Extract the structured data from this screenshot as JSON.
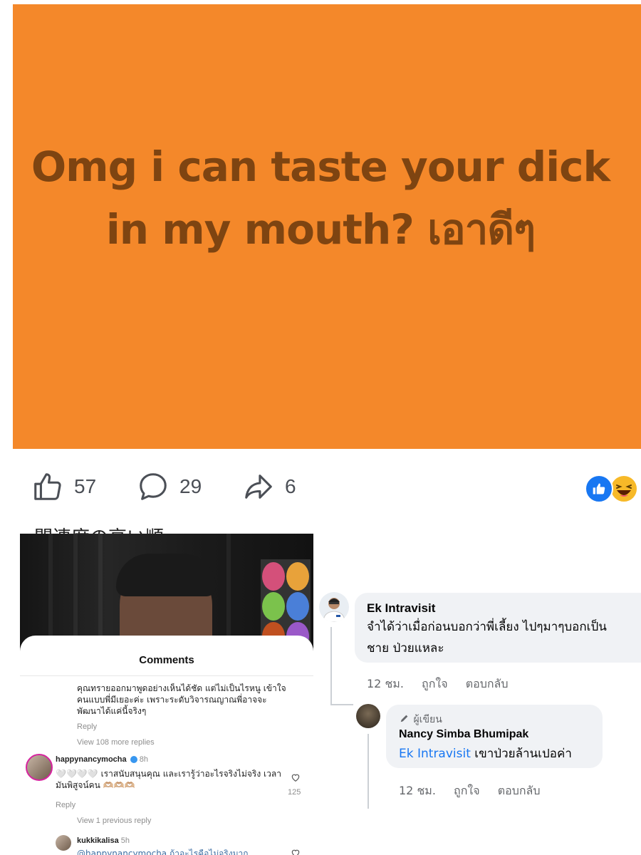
{
  "post": {
    "text": "Omg i can taste your dick in my mouth? เอาดีๆ",
    "background": "#f4882a",
    "text_color": "#7e4411"
  },
  "actions": {
    "like_icon": "thumbs-up-icon",
    "like_count": "57",
    "comment_icon": "comment-bubble-icon",
    "comment_count": "29",
    "share_icon": "share-arrow-icon",
    "share_count": "6",
    "reactions": [
      "like-reaction-icon",
      "haha-reaction-icon"
    ]
  },
  "left_screenshot": {
    "cut_title": "関連度の高い順",
    "sheet_title": "Comments",
    "first_comment": "คุณทรายออกมาพูดอย่างเห็นได้ชัด แต่ไม่เป็นไรหนู เข้าใจคนแบบพี่มีเยอะค่ะ เพราะระดับวิจารณญาณพี่อาจจะพัฒนาได้แค่นี้จริงๆ",
    "reply": "Reply",
    "view_more": "View 108 more replies",
    "c2_user": "happynancymocha",
    "c2_time": "8h",
    "c2_text": "🤍🤍🤍🤍 เราสนับสนุนคุณ และเรารู้ว่าอะไรจริงไม่จริง เวลามันพิสูจน์คน 🫶🏼🫶🏼🫶🏼",
    "c2_likes": "125",
    "c2_reply": "Reply",
    "view_previous": "View 1 previous reply",
    "c3_user": "kukkikalisa",
    "c3_time": "5h",
    "c3_text": "@happynancymocha ถ้าอะไรคือไม่จริงมาก"
  },
  "fb_comments": {
    "c1_name": "Ek Intravisit",
    "c1_line1": "จำได้ว่าเมื่อก่อนบอกว่าพี่เลี้ยง ไปๆมาๆบอกเป็น",
    "c1_line2": "ชาย ป่วยแหละ",
    "c1_time": "12 ชม.",
    "c1_like": "ถูกใจ",
    "c1_reply": "ตอบกลับ",
    "c2_badge": "ผู้เขียน",
    "c2_badge_icon": "pencil-icon",
    "c2_name": "Nancy Simba Bhumipak",
    "c2_mention": "Ek Intravisit",
    "c2_text": "เขาป่วยล้านเปอค่า",
    "c2_time": "12 ชม.",
    "c2_like": "ถูกใจ",
    "c2_reply": "ตอบกลับ"
  }
}
